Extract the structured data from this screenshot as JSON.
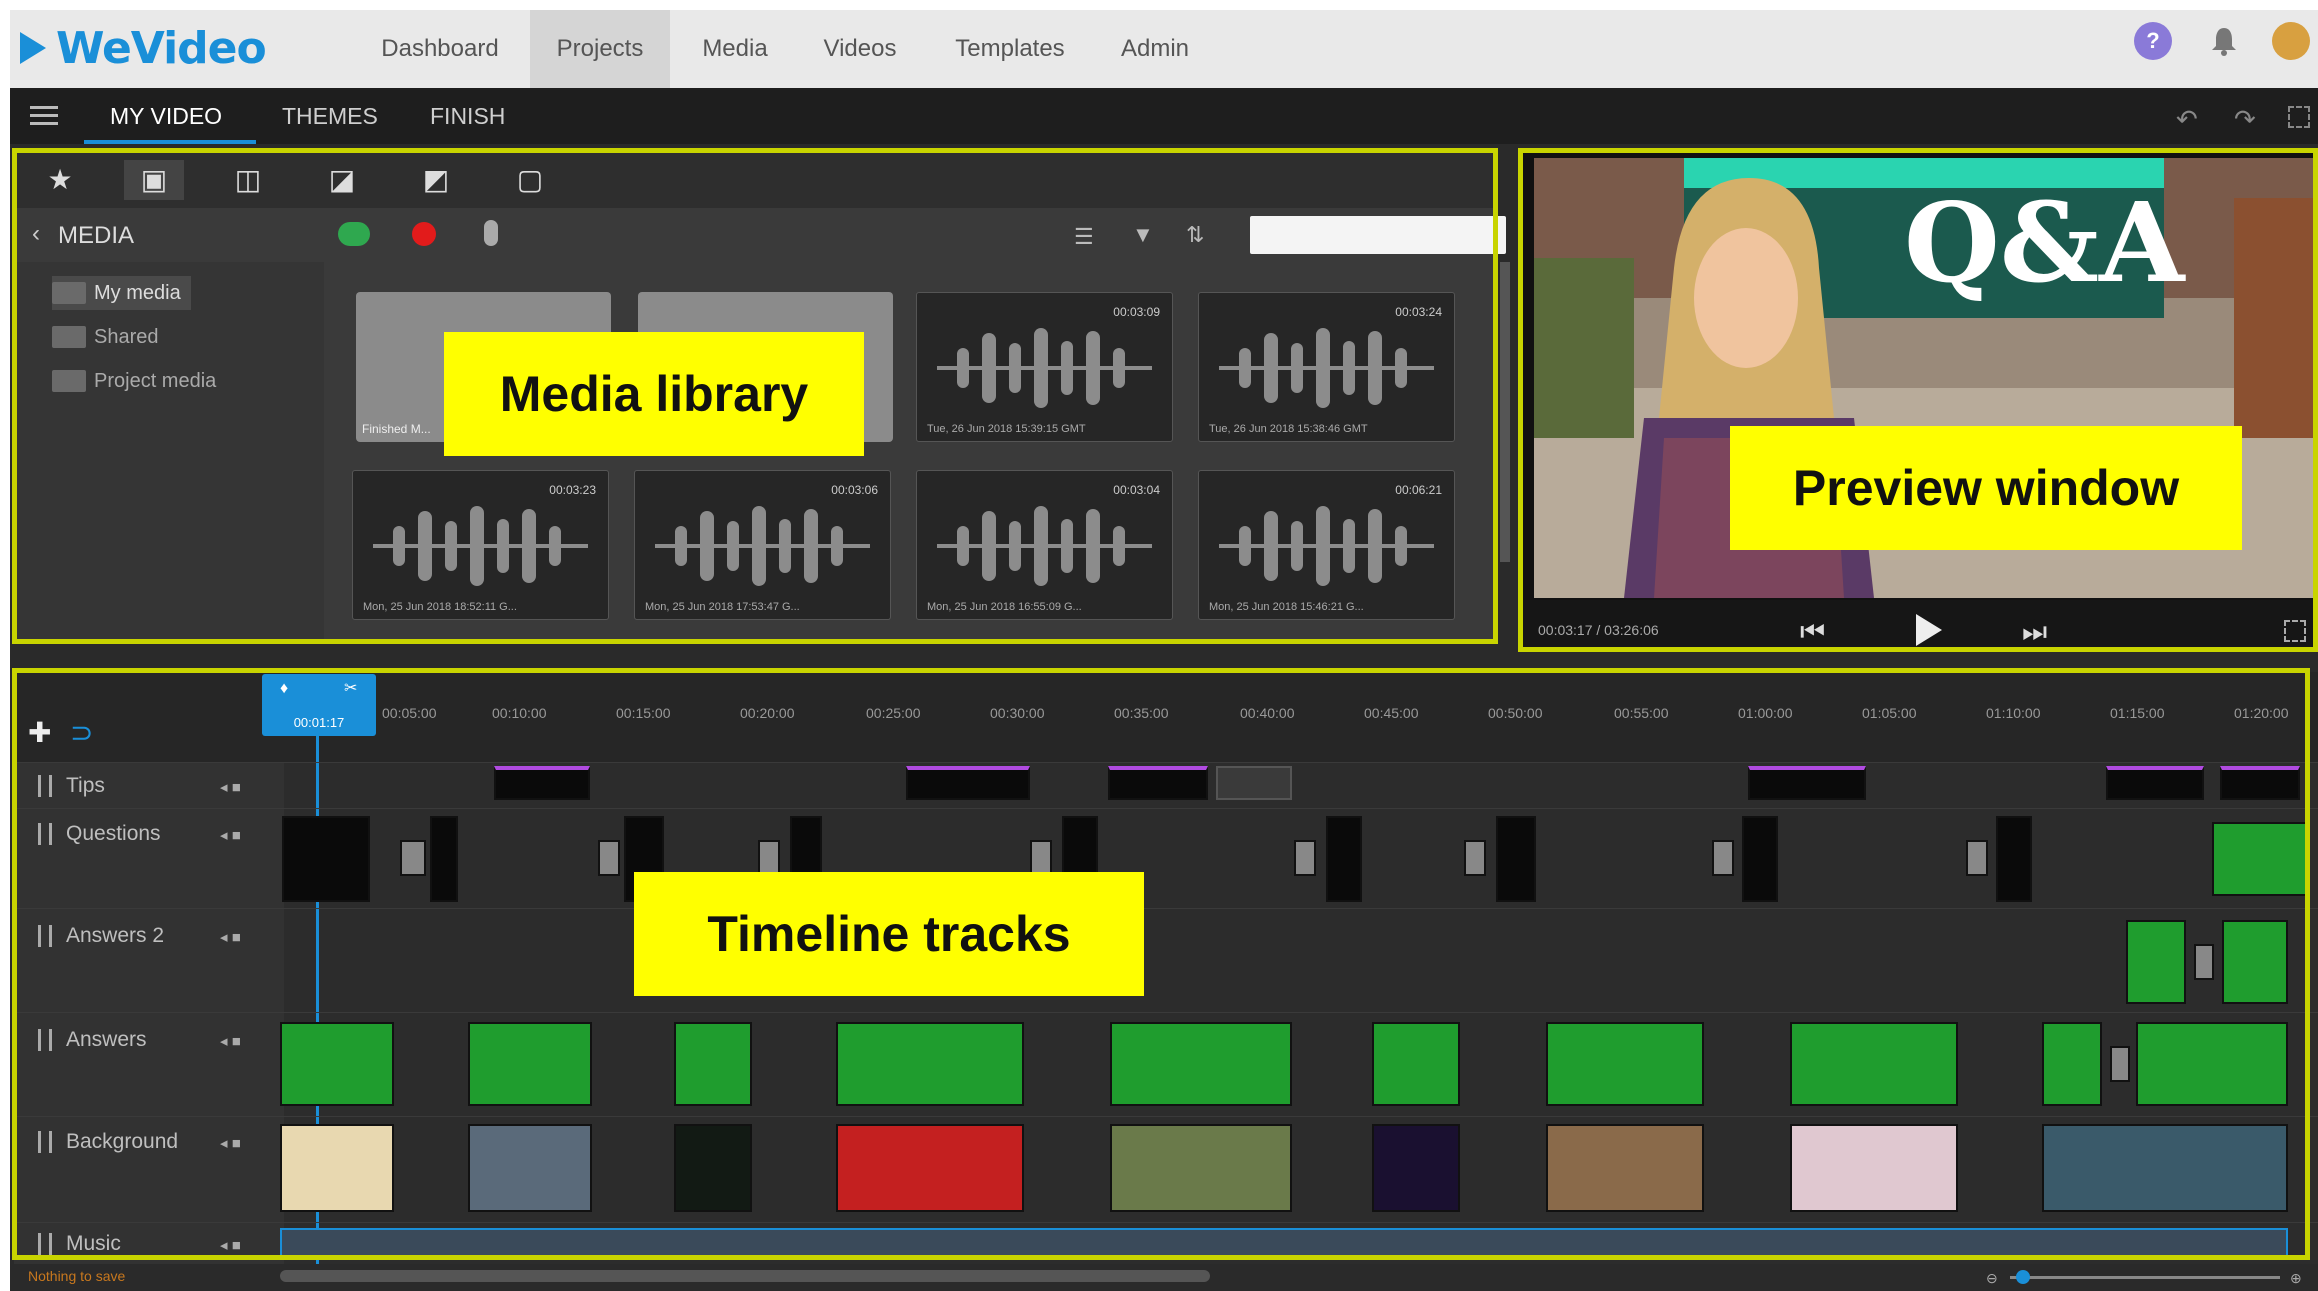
{
  "brand": {
    "logo_text": "WeVideo",
    "accent": "#1a8fd8"
  },
  "topnav": {
    "items": [
      {
        "label": "Dashboard"
      },
      {
        "label": "Projects"
      },
      {
        "label": "Media"
      },
      {
        "label": "Videos"
      },
      {
        "label": "Templates"
      },
      {
        "label": "Admin"
      }
    ],
    "active": "Projects"
  },
  "editor_tabs": [
    {
      "label": "MY VIDEO"
    },
    {
      "label": "THEMES"
    },
    {
      "label": "FINISH"
    }
  ],
  "media": {
    "title": "MEDIA",
    "sidebar": [
      {
        "label": "My media"
      },
      {
        "label": "Shared"
      },
      {
        "label": "Project media"
      }
    ],
    "folders": [
      {
        "label": "Finished M..."
      },
      {
        "label": ""
      }
    ],
    "audio_tiles": [
      {
        "duration": "00:03:09",
        "caption": "Tue, 26 Jun 2018 15:39:15 GMT"
      },
      {
        "duration": "00:03:24",
        "caption": "Tue, 26 Jun 2018 15:38:46 GMT"
      },
      {
        "duration": "00:03:23",
        "caption": "Mon, 25 Jun 2018 18:52:11 G..."
      },
      {
        "duration": "00:03:06",
        "caption": "Mon, 25 Jun 2018 17:53:47 G..."
      },
      {
        "duration": "00:03:04",
        "caption": "Mon, 25 Jun 2018 16:55:09 G..."
      },
      {
        "duration": "00:06:21",
        "caption": "Mon, 25 Jun 2018 15:46:21 G..."
      }
    ]
  },
  "preview": {
    "overlay_text": "Q&A",
    "timecode": "00:03:17 / 03:26:06"
  },
  "timeline": {
    "playhead_time": "00:01:17",
    "ruler_ticks": [
      "00:05:00",
      "00:10:00",
      "00:15:00",
      "00:20:00",
      "00:25:00",
      "00:30:00",
      "00:35:00",
      "00:40:00",
      "00:45:00",
      "00:50:00",
      "00:55:00",
      "01:00:00",
      "01:05:00",
      "01:10:00",
      "01:15:00",
      "01:20:00"
    ],
    "tracks": [
      {
        "name": "Tips"
      },
      {
        "name": "Questions"
      },
      {
        "name": "Answers 2"
      },
      {
        "name": "Answers"
      },
      {
        "name": "Background"
      },
      {
        "name": "Music"
      }
    ],
    "status_text": "Nothing to save"
  },
  "annotations": {
    "media_library": "Media library",
    "preview_window": "Preview window",
    "timeline_tracks": "Timeline tracks",
    "highlight_color": "#c8d400",
    "label_color": "#ffff00"
  }
}
